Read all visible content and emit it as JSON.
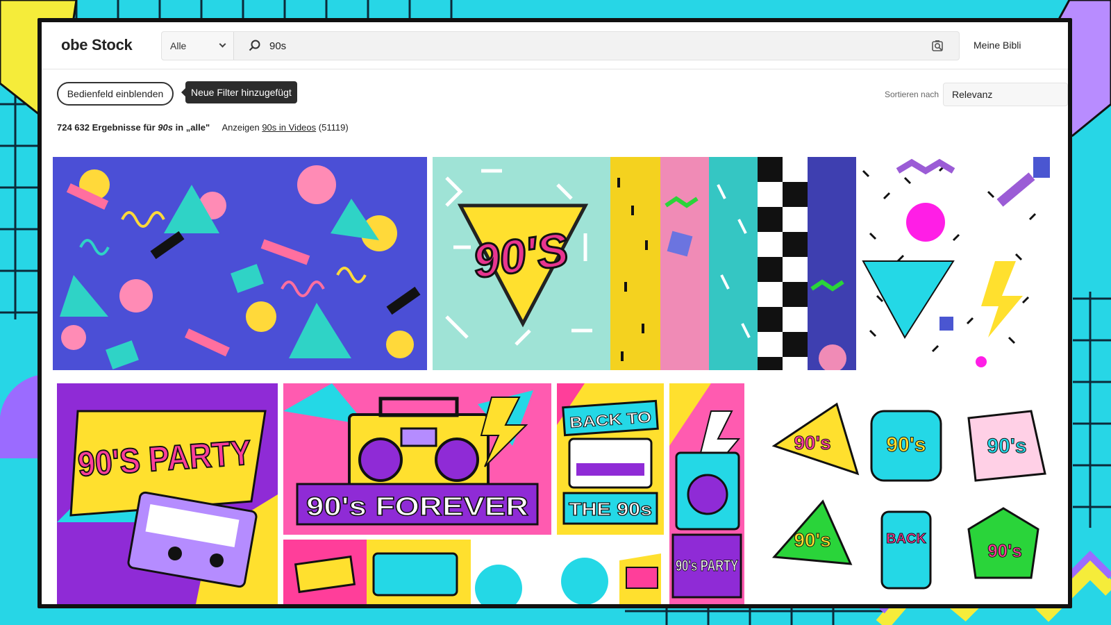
{
  "header": {
    "logo_text": "obe Stock",
    "category": {
      "selected": "Alle"
    },
    "search": {
      "value": "90s",
      "placeholder": ""
    },
    "library_label": "Meine Bibli"
  },
  "filters": {
    "panel_button_label": "Bedienfeld einblenden",
    "tooltip_text": "Neue Filter hinzugefügt",
    "sort_label": "Sortieren nach",
    "sort_value": "Relevanz"
  },
  "results": {
    "count": "724 632",
    "text_mid": "Ergebnisse für",
    "query": "90s",
    "text_scope": "in „alle\"",
    "videos_prefix": "Anzeigen",
    "videos_link": "90s in Videos",
    "videos_count": "(51119)"
  },
  "thumbnails": [
    {
      "name": "memphis-pattern-blue"
    },
    {
      "name": "90s-triangle-badge",
      "text": "90'S"
    },
    {
      "name": "pattern-strips"
    },
    {
      "name": "memphis-pattern-black-white"
    },
    {
      "name": "90s-party-poster",
      "text": "90'S PARTY"
    },
    {
      "name": "90s-forever-boombox",
      "text": "90's FOREVER"
    },
    {
      "name": "back-to-the-90s",
      "text_top": "BACK TO",
      "text_bottom": "THE 90s"
    },
    {
      "name": "90s-party-tall",
      "text": "90's PARTY"
    },
    {
      "name": "90s-sticker-set",
      "stickers": [
        "90's",
        "90's",
        "90's",
        "90's",
        "BACK",
        "90's"
      ]
    }
  ],
  "colors": {
    "accent_cyan": "#27d6e6",
    "accent_purple": "#9b6bff",
    "accent_yellow": "#f5ec3a",
    "accent_pink": "#ff3e9a"
  }
}
